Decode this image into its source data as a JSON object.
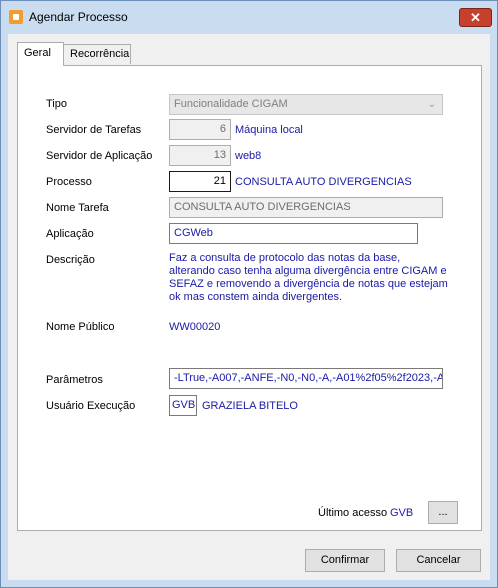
{
  "window": {
    "title": "Agendar Processo",
    "close_glyph": "✕"
  },
  "tabs": [
    {
      "label": "Geral"
    },
    {
      "label": "Recorrência"
    }
  ],
  "form": {
    "tipo": {
      "label": "Tipo",
      "value": "Funcionalidade CIGAM"
    },
    "servidor_tarefas": {
      "label": "Servidor de Tarefas",
      "value": "6",
      "desc": "Máquina local"
    },
    "servidor_aplicacao": {
      "label": "Servidor de Aplicação",
      "value": "13",
      "desc": "web8"
    },
    "processo": {
      "label": "Processo",
      "value": "21",
      "desc": "CONSULTA AUTO DIVERGENCIAS"
    },
    "nome_tarefa": {
      "label": "Nome Tarefa",
      "value": "CONSULTA AUTO DIVERGENCIAS"
    },
    "aplicacao": {
      "label": "Aplicação",
      "value": "CGWeb"
    },
    "descricao": {
      "label": "Descrição",
      "value": "Faz a consulta de protocolo das notas da base, alterando caso tenha alguma divergência entre CIGAM e SEFAZ e removendo a divergência de notas que estejam ok mas constem ainda divergentes."
    },
    "nome_publico": {
      "label": "Nome Público",
      "value": "WW00020"
    },
    "parametros": {
      "label": "Parâmetros",
      "value": "-LTrue,-A007,-ANFE,-N0,-N0,-A,-A01%2f05%2f2023,-A"
    },
    "usuario_execucao": {
      "label": "Usuário Execução",
      "code": "GVB",
      "name": "GRAZIELA BITELO"
    }
  },
  "ultimo_acesso": {
    "label": "Último acesso",
    "value": "GVB",
    "button": "..."
  },
  "buttons": {
    "confirmar": "Confirmar",
    "cancelar": "Cancelar"
  }
}
